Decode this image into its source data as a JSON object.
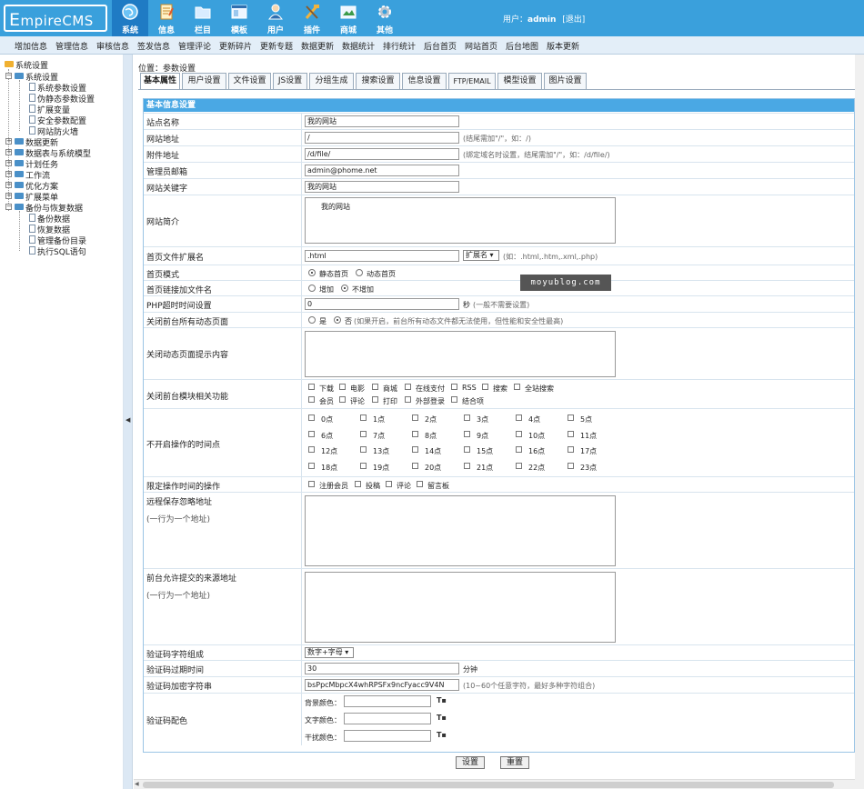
{
  "logo": {
    "e": "E",
    "rest": "mpireCMS"
  },
  "nav": [
    {
      "label": "系统",
      "icon": "globe-icon",
      "active": true
    },
    {
      "label": "信息",
      "icon": "notepad-icon"
    },
    {
      "label": "栏目",
      "icon": "folder-icon"
    },
    {
      "label": "模板",
      "icon": "template-icon"
    },
    {
      "label": "用户",
      "icon": "user-icon"
    },
    {
      "label": "插件",
      "icon": "tools-icon"
    },
    {
      "label": "商城",
      "icon": "shop-icon"
    },
    {
      "label": "其他",
      "icon": "gear-icon"
    }
  ],
  "user": {
    "prefix": "用户：",
    "name": "admin",
    "logout": "[退出]"
  },
  "menubar": [
    "增加信息",
    "管理信息",
    "审核信息",
    "签发信息",
    "管理评论",
    "更新碎片",
    "更新专题",
    "数据更新",
    "数据统计",
    "排行统计",
    "后台首页",
    "网站首页",
    "后台地图",
    "版本更新"
  ],
  "tree": {
    "root": "系统设置",
    "sys": "系统设置",
    "sys_children": [
      "系统参数设置",
      "伪静态参数设置",
      "扩展变量",
      "安全参数配置",
      "网站防火墙"
    ],
    "groups": [
      "数据更新",
      "数据表与系统模型",
      "计划任务",
      "工作流",
      "优化方案",
      "扩展菜单"
    ],
    "backup": "备份与恢复数据",
    "backup_children": [
      "备份数据",
      "恢复数据",
      "管理备份目录",
      "执行SQL语句"
    ]
  },
  "location": "位置：参数设置",
  "tabs": [
    "基本属性",
    "用户设置",
    "文件设置",
    "JS设置",
    "分组生成",
    "搜索设置",
    "信息设置",
    "FTP/EMAIL",
    "模型设置",
    "图片设置"
  ],
  "form_title": "基本信息设置",
  "fields": {
    "sitename": {
      "label": "站点名称",
      "value": "我的网站"
    },
    "siteurl": {
      "label": "网站地址",
      "value": "/",
      "hint": "(结尾需加\"/\"，如：/)"
    },
    "fileurl": {
      "label": "附件地址",
      "value": "/d/file/",
      "hint": "(绑定域名时设置，结尾需加\"/\"，如：/d/file/)"
    },
    "email": {
      "label": "管理员邮箱",
      "value": "admin@phome.net"
    },
    "keywords": {
      "label": "网站关键字",
      "value": "我的网站"
    },
    "intro": {
      "label": "网站简介",
      "value": "我的网站"
    },
    "indexext": {
      "label": "首页文件扩展名",
      "value": ".html",
      "select": "扩展名",
      "hint": "(如：.html,.htm,.xml,.php)"
    },
    "indexmode": {
      "label": "首页模式",
      "opt1": "静态首页",
      "opt2": "动态首页"
    },
    "indexlink": {
      "label": "首页链接加文件名",
      "opt1": "增加",
      "opt2": "不增加"
    },
    "phptimeout": {
      "label": "PHP超时时间设置",
      "value": "0",
      "unit": "秒",
      "hint": "(一般不需要设置)"
    },
    "closedyn": {
      "label": "关闭前台所有动态页面",
      "opt1": "是",
      "opt2": "否",
      "hint": "(如果开启，前台所有动态文件都无法使用，但性能和安全性最高)"
    },
    "closemsg": {
      "label": "关闭动态页面提示内容"
    },
    "closemods": {
      "label": "关闭前台模块相关功能",
      "items": [
        "下载",
        "电影",
        "商城",
        "在线支付",
        "RSS",
        "搜索",
        "全站搜索",
        "会员",
        "评论",
        "打印",
        "外部登录",
        "结合项"
      ]
    },
    "hours": {
      "label": "不开启操作的时间点",
      "items": [
        "0点",
        "1点",
        "2点",
        "3点",
        "4点",
        "5点",
        "6点",
        "7点",
        "8点",
        "9点",
        "10点",
        "11点",
        "12点",
        "13点",
        "14点",
        "15点",
        "16点",
        "17点",
        "18点",
        "19点",
        "20点",
        "21点",
        "22点",
        "23点"
      ]
    },
    "limitops": {
      "label": "限定操作时间的操作",
      "items": [
        "注册会员",
        "投稿",
        "评论",
        "留言板"
      ]
    },
    "remotesave": {
      "label": "远程保存忽略地址",
      "sub": "(一行为一个地址)"
    },
    "allowsrc": {
      "label": "前台允许提交的来源地址",
      "sub": "(一行为一个地址)"
    },
    "vcode": {
      "label": "验证码字符组成",
      "select": "数字+字母"
    },
    "vexpire": {
      "label": "验证码过期时间",
      "value": "30",
      "unit": "分钟"
    },
    "vkey": {
      "label": "验证码加密字符串",
      "value": "bsPpcMbpcX4whRPSFx9ncFyacc9V4N",
      "hint": "(10~60个任意字符，最好多种字符组合)"
    },
    "vcolor": {
      "label": "验证码配色",
      "bg": "背景颜色：",
      "fg": "文字颜色：",
      "noise": "干扰颜色："
    }
  },
  "buttons": {
    "submit": "设置",
    "reset": "重置"
  },
  "watermark": "moyublog.com"
}
